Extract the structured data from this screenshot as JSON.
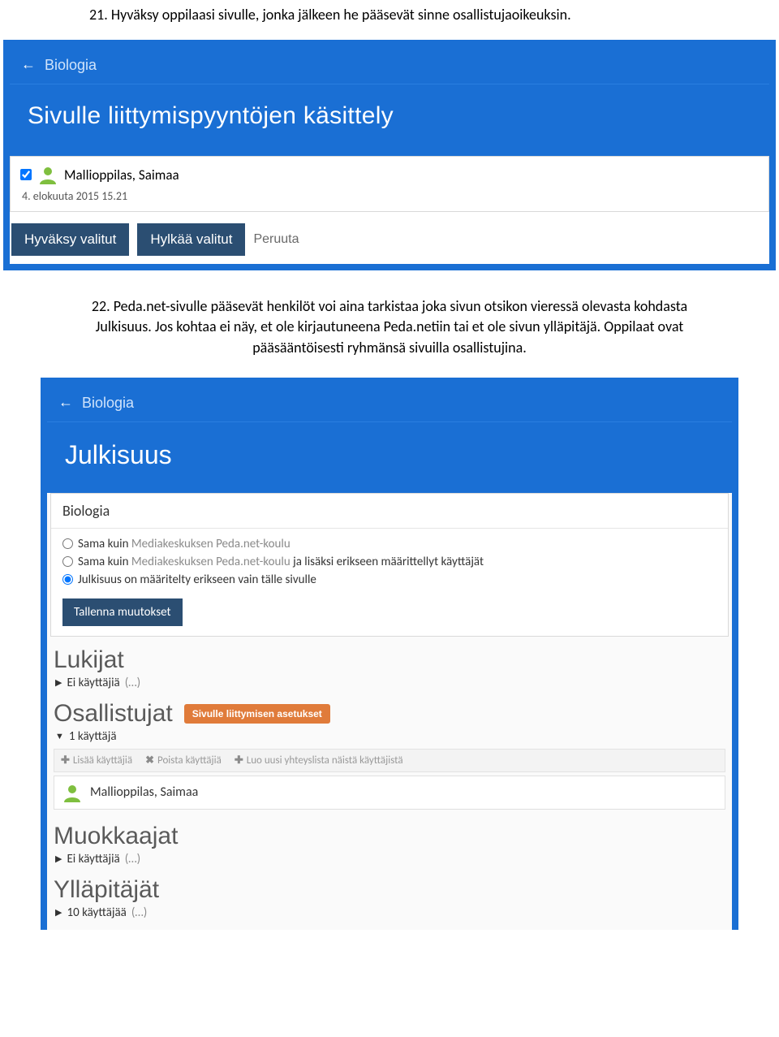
{
  "doc": {
    "step21": "21. Hyväksy oppilaasi sivulle, jonka jälkeen he pääsevät sinne osallistujaoikeuksin.",
    "step22": "22. Peda.net-sivulle pääsevät henkilöt voi aina tarkistaa joka sivun otsikon vieressä olevasta kohdasta Julkisuus. Jos kohtaa ei näy, et ole kirjautuneena Peda.netiin tai et ole sivun ylläpitäjä. Oppilaat ovat pääsääntöisesti ryhmänsä sivuilla osallistujina."
  },
  "shot1": {
    "breadcrumb_arrow": "←",
    "breadcrumb": "Biologia",
    "title": "Sivulle liittymispyyntöjen käsittely",
    "user_name": "Mallioppilas, Saimaa",
    "user_checked": true,
    "date": "4. elokuuta 2015 15.21",
    "accept": "Hyväksy valitut",
    "reject": "Hylkää valitut",
    "cancel": "Peruuta"
  },
  "shot2": {
    "breadcrumb_arrow": "←",
    "breadcrumb": "Biologia",
    "title": "Julkisuus",
    "card_title": "Biologia",
    "radio": {
      "opt1_prefix": "Sama kuin ",
      "opt1_link": "Mediakeskuksen Peda.net-koulu",
      "opt2_prefix": "Sama kuin ",
      "opt2_link": "Mediakeskuksen Peda.net-koulu",
      "opt2_suffix": " ja lisäksi erikseen määrittellyt käyttäjät",
      "opt3": "Julkisuus on määritelty erikseen vain tälle sivulle"
    },
    "save": "Tallenna muutokset",
    "readers_h": "Lukijat",
    "readers_line": "Ei käyttäjiä",
    "readers_dots": "(…)",
    "participants_h": "Osallistujat",
    "participants_pill": "Sivulle liittymisen asetukset",
    "participants_line": "1 käyttäjä",
    "toolbar": {
      "add": "Lisää käyttäjiä",
      "remove": "Poista käyttäjiä",
      "create": "Luo uusi yhteyslista näistä käyttäjistä"
    },
    "participant_user": "Mallioppilas, Saimaa",
    "editors_h": "Muokkaajat",
    "editors_line": "Ei käyttäjiä",
    "editors_dots": "(…)",
    "admins_h": "Ylläpitäjät",
    "admins_line": "10 käyttäjää",
    "admins_dots": "(…)"
  },
  "icons": {
    "avatar_color": "#7fbf3f"
  }
}
